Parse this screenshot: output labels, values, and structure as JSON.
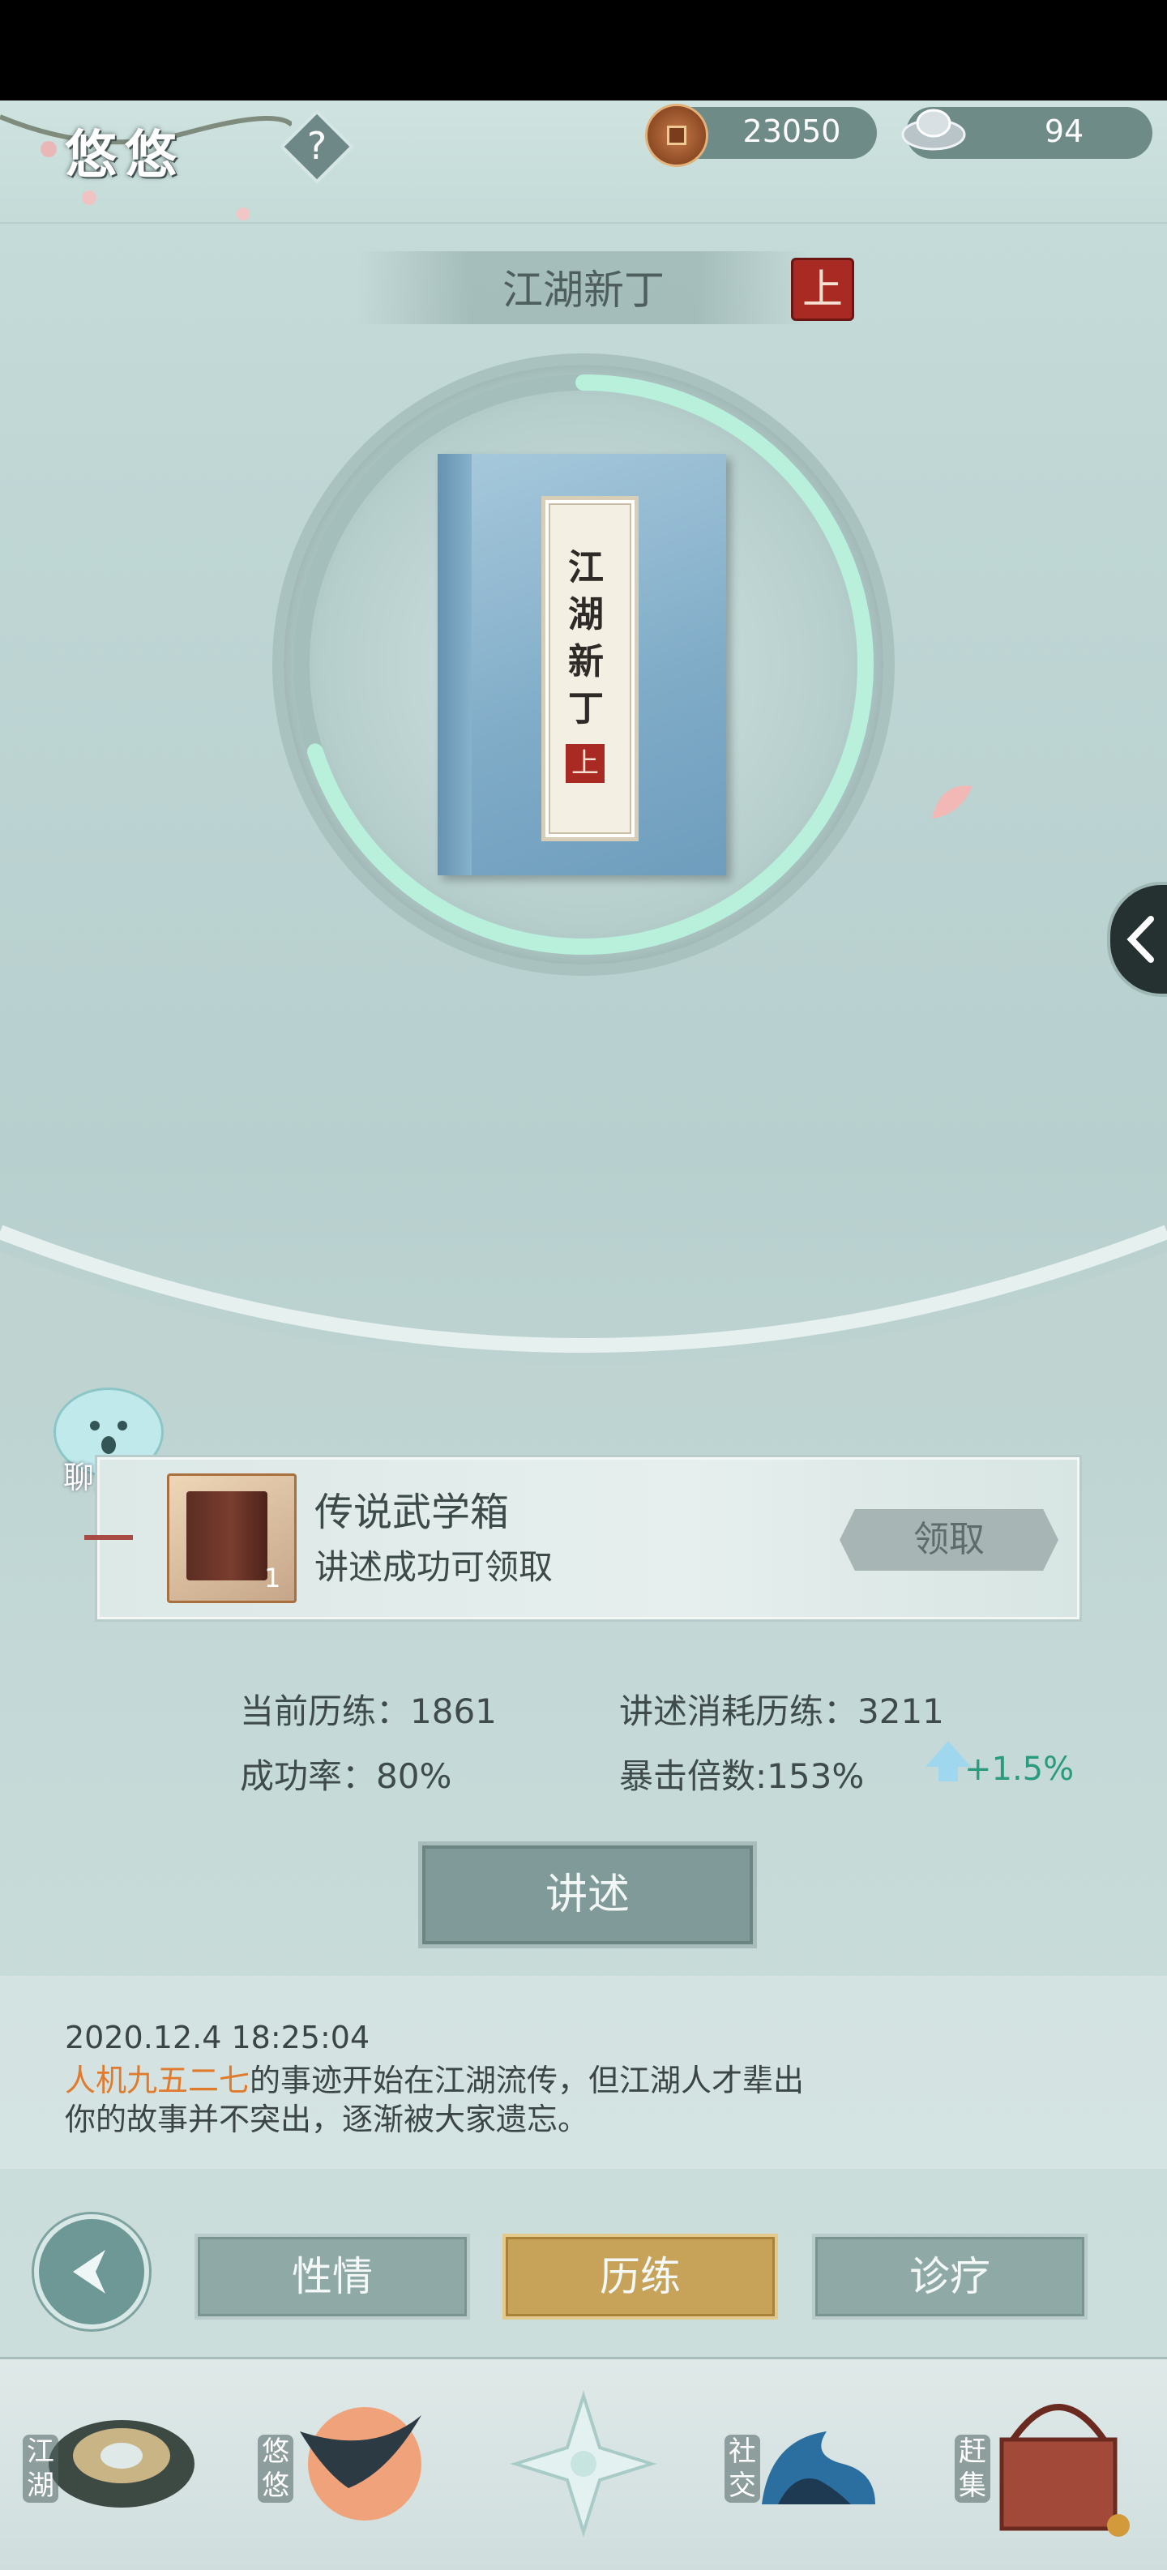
{
  "header": {
    "player_name": "悠悠",
    "help_symbol": "?",
    "coins": "23050",
    "silver": "94"
  },
  "main": {
    "title": "江湖新丁",
    "title_seal": "上",
    "book_chars": [
      "江",
      "湖",
      "新",
      "丁"
    ],
    "book_seal": "上",
    "progress_fraction": 0.7
  },
  "chat": {
    "label": "聊天"
  },
  "reward": {
    "title": "传说武学箱",
    "subtitle": "讲述成功可领取",
    "count": "1",
    "claim_label": "领取"
  },
  "stats": {
    "current_exp": "当前历练：1861",
    "cost_exp": "讲述消耗历练：3211",
    "success_rate": "成功率：80%",
    "crit_multiplier": "暴击倍数:153%",
    "bonus": "+1.5%"
  },
  "action": {
    "tell_label": "讲述"
  },
  "log": {
    "timestamp": "2020.12.4 18:25:04",
    "name": "人机九五二七",
    "line1_rest": "的事迹开始在江湖流传，但江湖人才辈出",
    "line2": "你的故事并不突出，逐渐被大家遗忘。"
  },
  "tabs": [
    {
      "label": "性情",
      "active": false
    },
    {
      "label": "历练",
      "active": true
    },
    {
      "label": "诊疗",
      "active": false
    }
  ],
  "bottom_nav": [
    {
      "label": "江湖",
      "icon": "hat-icon"
    },
    {
      "label": "悠悠",
      "icon": "bird-icon"
    },
    {
      "label": "",
      "icon": "compass-star-icon"
    },
    {
      "label": "社交",
      "icon": "wave-icon"
    },
    {
      "label": "赶集",
      "icon": "basket-icon"
    }
  ],
  "colors": {
    "accent_gold": "#c7a35a",
    "name_orange": "#e07b2d",
    "bonus_green": "#2b9a7e",
    "progress": "#b8f0dc"
  }
}
